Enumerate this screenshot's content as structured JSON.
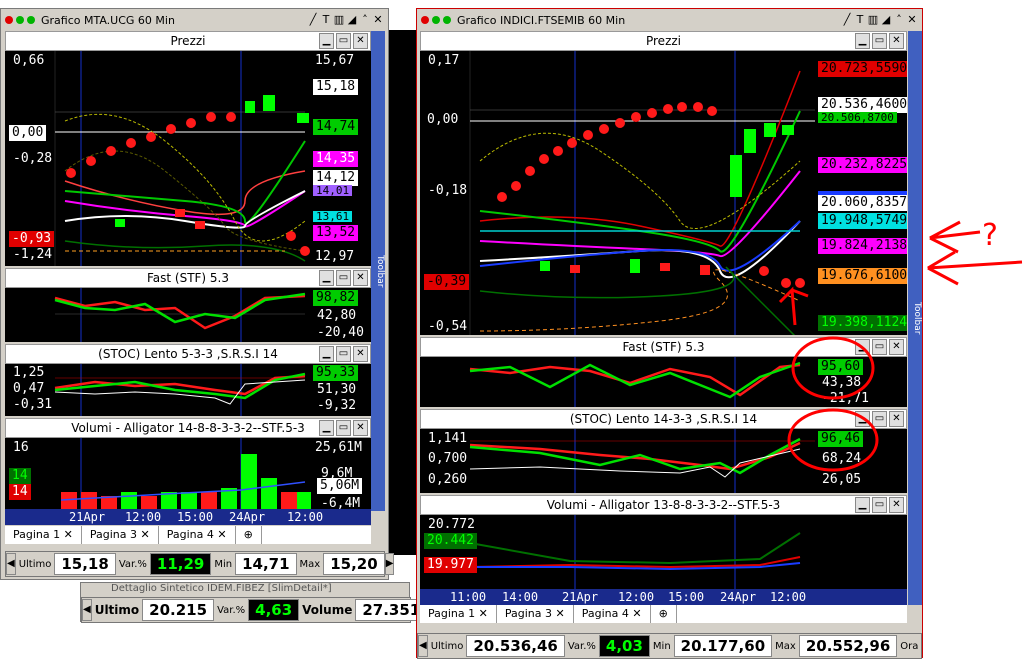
{
  "left_window": {
    "title": "Grafico MTA.UCG 60 Min",
    "price_panel": {
      "title": "Prezzi",
      "left_axis": [
        "0,66",
        "0,00",
        "-0,28",
        "-0,93",
        "-1,24"
      ],
      "right_values": [
        "15,67",
        "15,18",
        "14,74",
        "14,35",
        "14,12",
        "14,01",
        "13,61",
        "13,52",
        "12,97"
      ]
    },
    "fast_panel": {
      "title": "Fast  (STF)   5.3",
      "right_values": [
        "98,82",
        "42,80",
        "-20,40"
      ]
    },
    "stoc_panel": {
      "title": "(STOC) Lento    5-3-3 ,S.R.S.I 14",
      "left_axis": [
        "1,25",
        "0,47",
        "-0,31"
      ],
      "right_values": [
        "95,33",
        "51,30",
        "-9,32"
      ]
    },
    "vol_panel": {
      "title": "Volumi - Alligator 14-8-8-3-3-2--STF.5-3",
      "left_axis": [
        "16",
        "14",
        "14"
      ],
      "right_values": [
        "25,61M",
        "9,6M",
        "5,06M",
        "-6,4M"
      ]
    },
    "xaxis": [
      "21Apr",
      "12:00",
      "15:00",
      "24Apr",
      "12:00"
    ],
    "tabs": [
      "Pagina 1",
      "Pagina 3",
      "Pagina 4"
    ],
    "ticker": {
      "ultimo_label": "Ultimo",
      "ultimo": "15,18",
      "var_label": "Var.%",
      "var": "11,29",
      "min_label": "Min",
      "min": "14,71",
      "max_label": "Max",
      "max": "15,20"
    }
  },
  "detail_window": {
    "title": "Dettaglio Sintetico IDEM.FIBEZ [SlimDetail*]",
    "ultimo_label": "Ultimo",
    "ultimo": "20.215",
    "var_label": "Var.%",
    "var": "4,63",
    "volume_label": "Volume",
    "volume": "27.351"
  },
  "right_window": {
    "title": "Grafico INDICI.FTSEMIB 60 Min",
    "price_panel": {
      "title": "Prezzi",
      "left_axis": [
        "0,17",
        "0,00",
        "-0,18",
        "-0,39",
        "-0,54"
      ],
      "right_values": [
        "20.723,5590",
        "20.536,4600",
        "20.506,8700",
        "20.232,8225",
        "20.060,8357",
        "19.948,5749",
        "19.824,2138",
        "19.676,6100",
        "19.398,1124"
      ]
    },
    "fast_panel": {
      "title": "Fast  (STF)   5.3",
      "right_values": [
        "95,60",
        "43,38",
        "-21,71"
      ]
    },
    "stoc_panel": {
      "title": "(STOC) Lento    14-3-3 ,S.R.S.I 14",
      "left_axis": [
        "1,141",
        "0,700",
        "0,260"
      ],
      "right_values": [
        "96,46",
        "68,24",
        "26,05"
      ]
    },
    "vol_panel": {
      "title": "Volumi - Alligator 13-8-8-3-3-2--STF.5-3",
      "left_axis": [
        "20.772",
        "20.442",
        "19.977"
      ]
    },
    "xaxis": [
      "11:00",
      "14:00",
      "21Apr",
      "12:00",
      "15:00",
      "24Apr",
      "12:00"
    ],
    "tabs": [
      "Pagina 1",
      "Pagina 3",
      "Pagina 4"
    ],
    "ticker": {
      "ultimo_label": "Ultimo",
      "ultimo": "20.536,46",
      "var_label": "Var.%",
      "var": "4,03",
      "min_label": "Min",
      "min": "20.177,60",
      "max_label": "Max",
      "max": "20.552,96",
      "ora_label": "Ora"
    }
  },
  "annotation": {
    "text": "?"
  },
  "toolbar_label": "Toolbar",
  "colors": {
    "red": "#ff0000",
    "green": "#00ff00",
    "magenta": "#ff00ff",
    "cyan": "#00ffff",
    "blue_axis": "#4060c0"
  }
}
